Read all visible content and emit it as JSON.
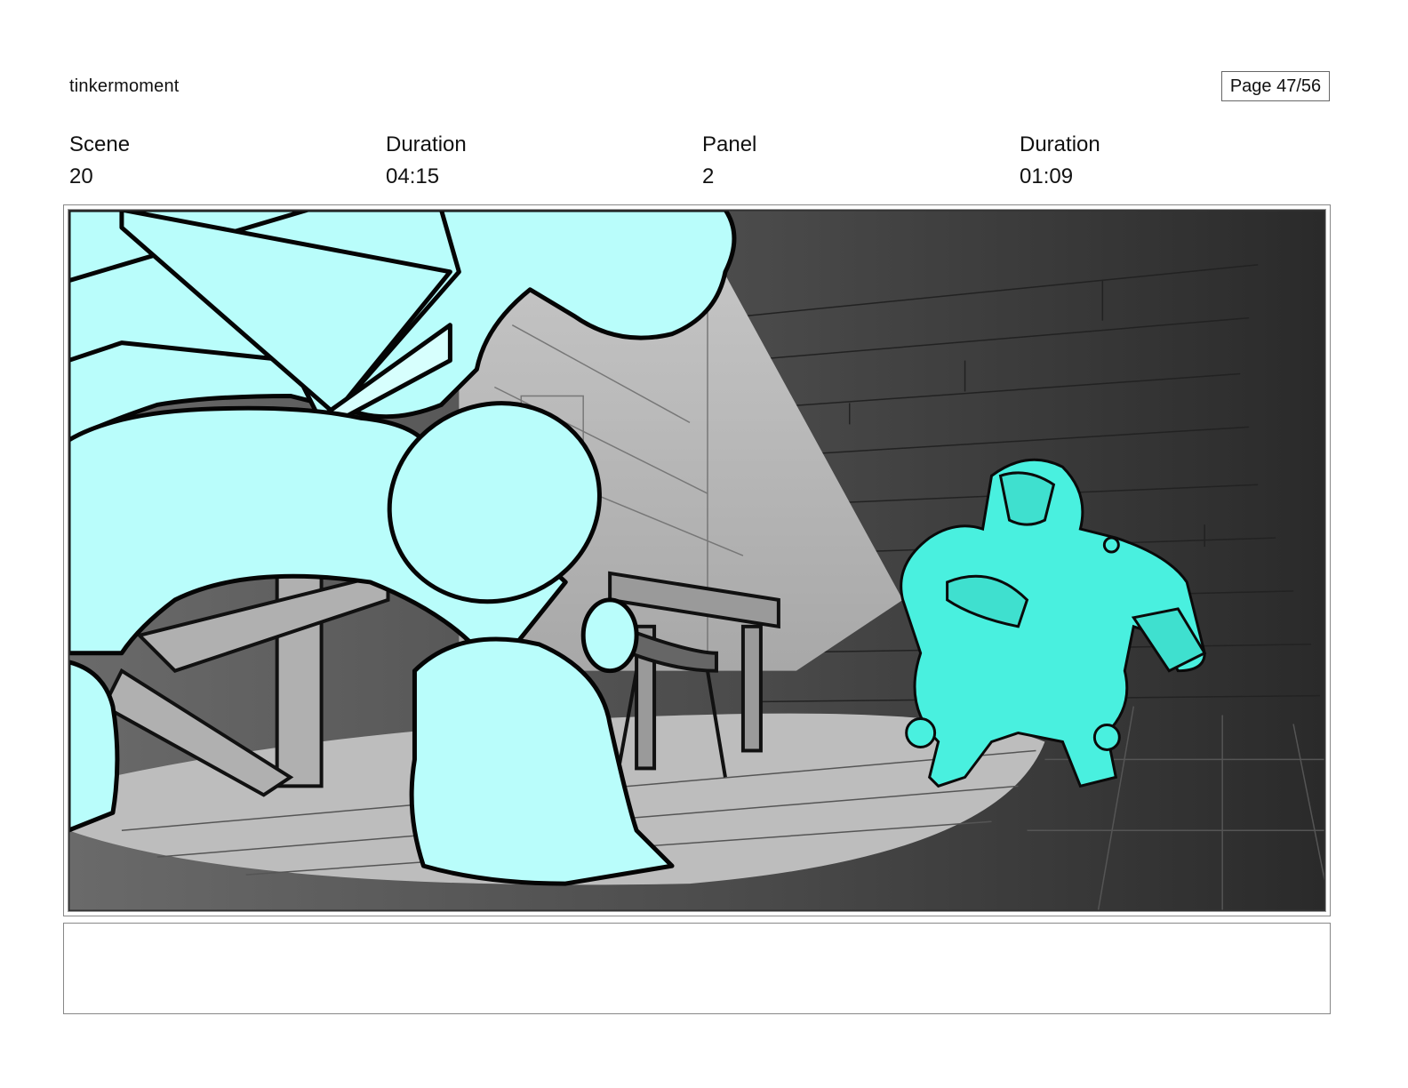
{
  "header": {
    "project_name": "tinkermoment",
    "page_label": "Page 47/56"
  },
  "meta": {
    "scene_label": "Scene",
    "scene_value": "20",
    "scene_duration_label": "Duration",
    "scene_duration_value": "04:15",
    "panel_label": "Panel",
    "panel_value": "2",
    "panel_duration_label": "Duration",
    "panel_duration_value": "01:09"
  },
  "notes": {
    "text": ""
  },
  "colors": {
    "foreground_character": "#b9fdfb",
    "background_character": "#49f0df",
    "spotlight": "#b9b9b9",
    "shadow_dark": "#2d2d2d"
  }
}
